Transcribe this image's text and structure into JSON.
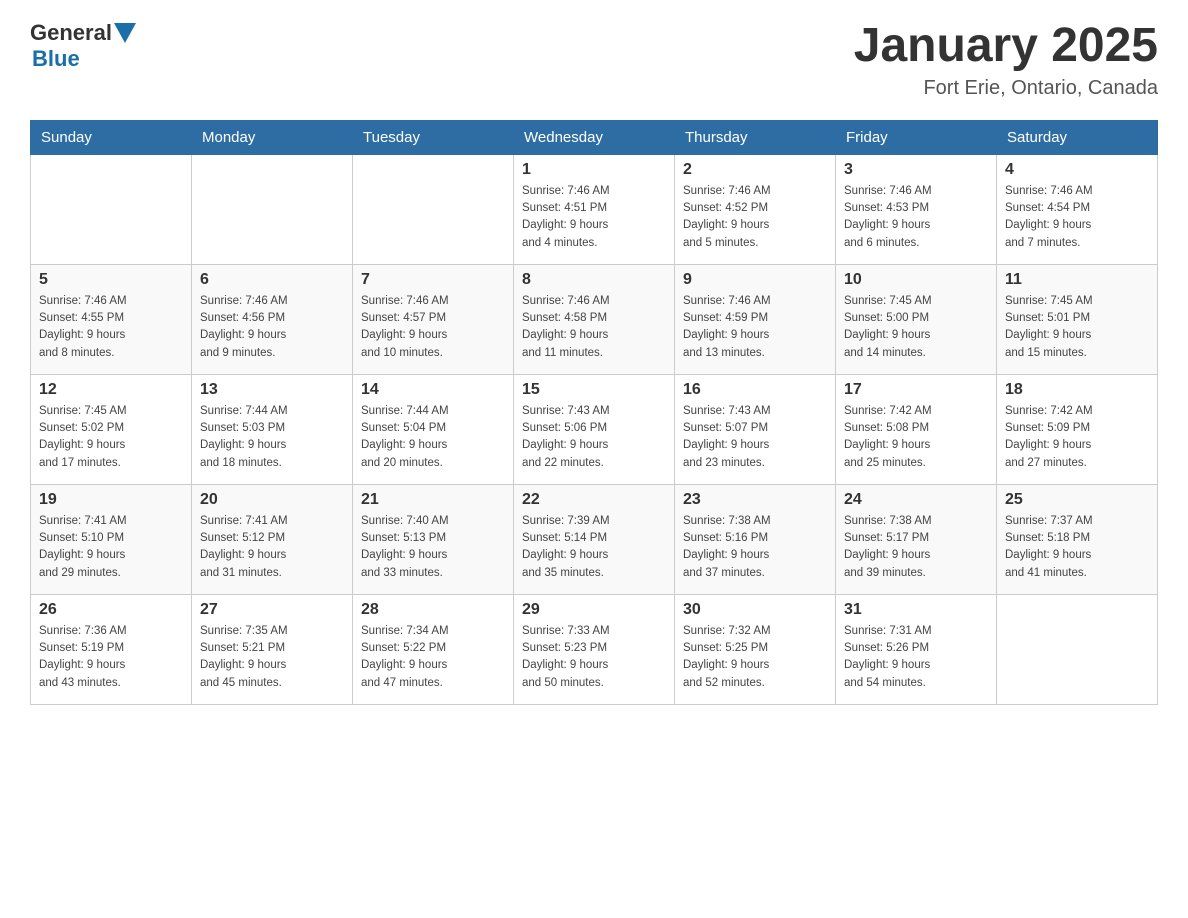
{
  "header": {
    "logo": {
      "general": "General",
      "blue": "Blue"
    },
    "title": "January 2025",
    "location": "Fort Erie, Ontario, Canada"
  },
  "weekdays": [
    "Sunday",
    "Monday",
    "Tuesday",
    "Wednesday",
    "Thursday",
    "Friday",
    "Saturday"
  ],
  "weeks": [
    [
      {
        "day": "",
        "info": ""
      },
      {
        "day": "",
        "info": ""
      },
      {
        "day": "",
        "info": ""
      },
      {
        "day": "1",
        "info": "Sunrise: 7:46 AM\nSunset: 4:51 PM\nDaylight: 9 hours\nand 4 minutes."
      },
      {
        "day": "2",
        "info": "Sunrise: 7:46 AM\nSunset: 4:52 PM\nDaylight: 9 hours\nand 5 minutes."
      },
      {
        "day": "3",
        "info": "Sunrise: 7:46 AM\nSunset: 4:53 PM\nDaylight: 9 hours\nand 6 minutes."
      },
      {
        "day": "4",
        "info": "Sunrise: 7:46 AM\nSunset: 4:54 PM\nDaylight: 9 hours\nand 7 minutes."
      }
    ],
    [
      {
        "day": "5",
        "info": "Sunrise: 7:46 AM\nSunset: 4:55 PM\nDaylight: 9 hours\nand 8 minutes."
      },
      {
        "day": "6",
        "info": "Sunrise: 7:46 AM\nSunset: 4:56 PM\nDaylight: 9 hours\nand 9 minutes."
      },
      {
        "day": "7",
        "info": "Sunrise: 7:46 AM\nSunset: 4:57 PM\nDaylight: 9 hours\nand 10 minutes."
      },
      {
        "day": "8",
        "info": "Sunrise: 7:46 AM\nSunset: 4:58 PM\nDaylight: 9 hours\nand 11 minutes."
      },
      {
        "day": "9",
        "info": "Sunrise: 7:46 AM\nSunset: 4:59 PM\nDaylight: 9 hours\nand 13 minutes."
      },
      {
        "day": "10",
        "info": "Sunrise: 7:45 AM\nSunset: 5:00 PM\nDaylight: 9 hours\nand 14 minutes."
      },
      {
        "day": "11",
        "info": "Sunrise: 7:45 AM\nSunset: 5:01 PM\nDaylight: 9 hours\nand 15 minutes."
      }
    ],
    [
      {
        "day": "12",
        "info": "Sunrise: 7:45 AM\nSunset: 5:02 PM\nDaylight: 9 hours\nand 17 minutes."
      },
      {
        "day": "13",
        "info": "Sunrise: 7:44 AM\nSunset: 5:03 PM\nDaylight: 9 hours\nand 18 minutes."
      },
      {
        "day": "14",
        "info": "Sunrise: 7:44 AM\nSunset: 5:04 PM\nDaylight: 9 hours\nand 20 minutes."
      },
      {
        "day": "15",
        "info": "Sunrise: 7:43 AM\nSunset: 5:06 PM\nDaylight: 9 hours\nand 22 minutes."
      },
      {
        "day": "16",
        "info": "Sunrise: 7:43 AM\nSunset: 5:07 PM\nDaylight: 9 hours\nand 23 minutes."
      },
      {
        "day": "17",
        "info": "Sunrise: 7:42 AM\nSunset: 5:08 PM\nDaylight: 9 hours\nand 25 minutes."
      },
      {
        "day": "18",
        "info": "Sunrise: 7:42 AM\nSunset: 5:09 PM\nDaylight: 9 hours\nand 27 minutes."
      }
    ],
    [
      {
        "day": "19",
        "info": "Sunrise: 7:41 AM\nSunset: 5:10 PM\nDaylight: 9 hours\nand 29 minutes."
      },
      {
        "day": "20",
        "info": "Sunrise: 7:41 AM\nSunset: 5:12 PM\nDaylight: 9 hours\nand 31 minutes."
      },
      {
        "day": "21",
        "info": "Sunrise: 7:40 AM\nSunset: 5:13 PM\nDaylight: 9 hours\nand 33 minutes."
      },
      {
        "day": "22",
        "info": "Sunrise: 7:39 AM\nSunset: 5:14 PM\nDaylight: 9 hours\nand 35 minutes."
      },
      {
        "day": "23",
        "info": "Sunrise: 7:38 AM\nSunset: 5:16 PM\nDaylight: 9 hours\nand 37 minutes."
      },
      {
        "day": "24",
        "info": "Sunrise: 7:38 AM\nSunset: 5:17 PM\nDaylight: 9 hours\nand 39 minutes."
      },
      {
        "day": "25",
        "info": "Sunrise: 7:37 AM\nSunset: 5:18 PM\nDaylight: 9 hours\nand 41 minutes."
      }
    ],
    [
      {
        "day": "26",
        "info": "Sunrise: 7:36 AM\nSunset: 5:19 PM\nDaylight: 9 hours\nand 43 minutes."
      },
      {
        "day": "27",
        "info": "Sunrise: 7:35 AM\nSunset: 5:21 PM\nDaylight: 9 hours\nand 45 minutes."
      },
      {
        "day": "28",
        "info": "Sunrise: 7:34 AM\nSunset: 5:22 PM\nDaylight: 9 hours\nand 47 minutes."
      },
      {
        "day": "29",
        "info": "Sunrise: 7:33 AM\nSunset: 5:23 PM\nDaylight: 9 hours\nand 50 minutes."
      },
      {
        "day": "30",
        "info": "Sunrise: 7:32 AM\nSunset: 5:25 PM\nDaylight: 9 hours\nand 52 minutes."
      },
      {
        "day": "31",
        "info": "Sunrise: 7:31 AM\nSunset: 5:26 PM\nDaylight: 9 hours\nand 54 minutes."
      },
      {
        "day": "",
        "info": ""
      }
    ]
  ]
}
